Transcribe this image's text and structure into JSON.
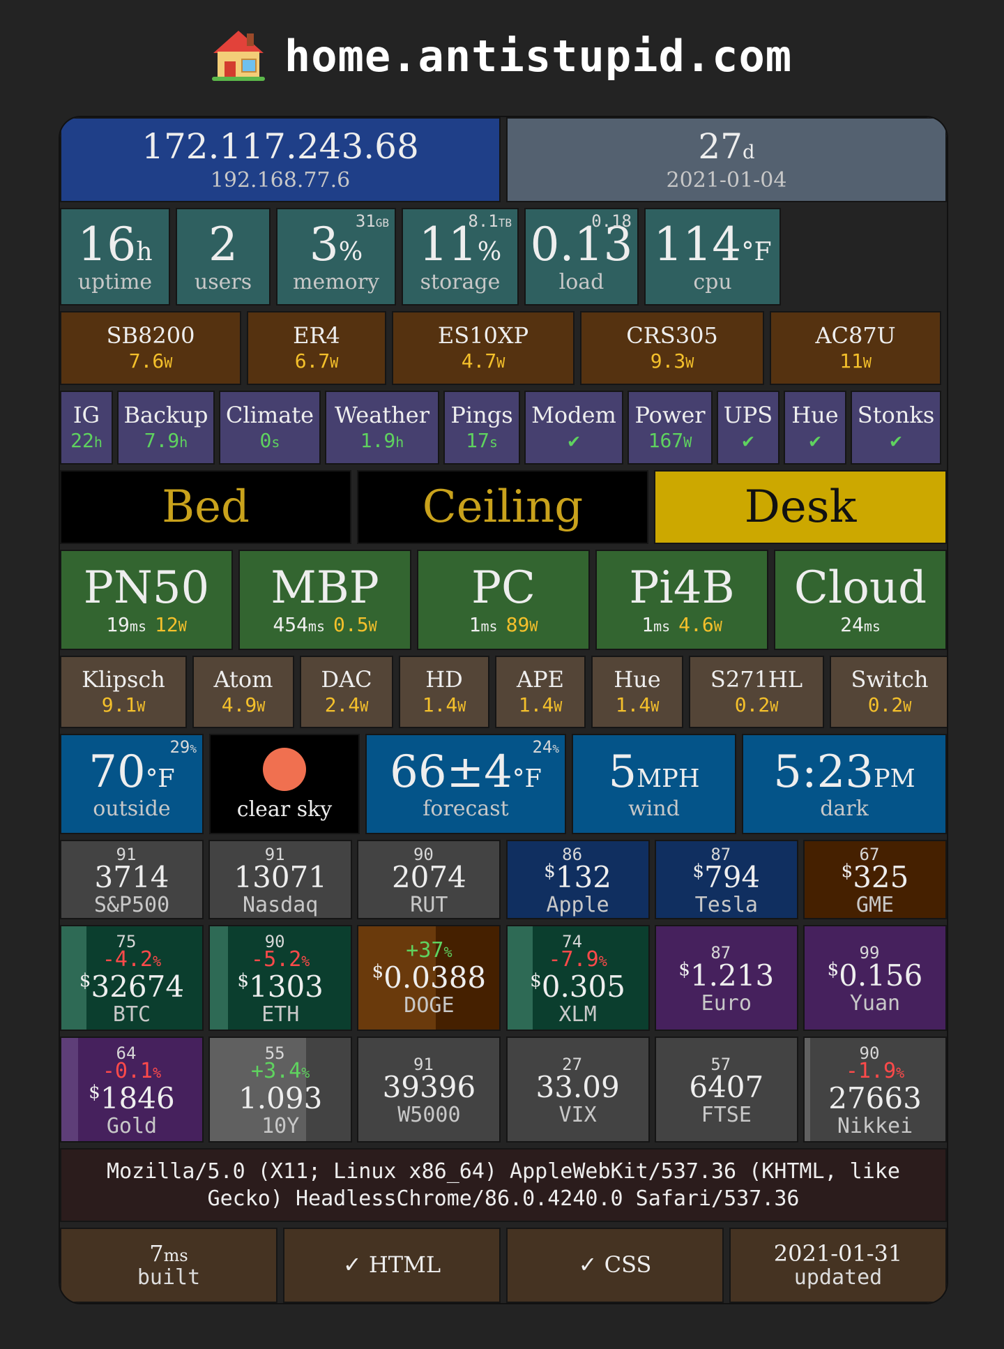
{
  "header": {
    "title": "home.antistupid.com",
    "icon": "house-icon"
  },
  "network": {
    "public_ip": "172.117.243.68",
    "local_ip": "192.168.77.6"
  },
  "age": {
    "value": "27",
    "unit": "d",
    "date": "2021-01-04"
  },
  "system": [
    {
      "value": "16",
      "unit": "h",
      "label": "uptime",
      "corner": "",
      "corner_unit": ""
    },
    {
      "value": "2",
      "unit": "",
      "label": "users",
      "corner": "",
      "corner_unit": ""
    },
    {
      "value": "3",
      "unit": "%",
      "label": "memory",
      "corner": "31",
      "corner_unit": "GB"
    },
    {
      "value": "11",
      "unit": "%",
      "label": "storage",
      "corner": "8.1",
      "corner_unit": "TB"
    },
    {
      "value": "0.13",
      "unit": "",
      "label": "load",
      "corner": "0.18",
      "corner_unit": ""
    },
    {
      "value": "114",
      "unit": "°F",
      "label": "cpu",
      "corner": "",
      "corner_unit": ""
    }
  ],
  "devices": [
    {
      "name": "SB8200",
      "value": "7.6",
      "unit": "W"
    },
    {
      "name": "ER4",
      "value": "6.7",
      "unit": "W"
    },
    {
      "name": "ES10XP",
      "value": "4.7",
      "unit": "W"
    },
    {
      "name": "CRS305",
      "value": "9.3",
      "unit": "W"
    },
    {
      "name": "AC87U",
      "value": "11",
      "unit": "W"
    }
  ],
  "services": [
    {
      "name": "IG",
      "value": "22",
      "unit": "h"
    },
    {
      "name": "Backup",
      "value": "7.9",
      "unit": "h"
    },
    {
      "name": "Climate",
      "value": "0",
      "unit": "s"
    },
    {
      "name": "Weather",
      "value": "1.9",
      "unit": "h"
    },
    {
      "name": "Pings",
      "value": "17",
      "unit": "s"
    },
    {
      "name": "Modem",
      "value": "✔",
      "unit": ""
    },
    {
      "name": "Power",
      "value": "167",
      "unit": "W"
    },
    {
      "name": "UPS",
      "value": "✔",
      "unit": ""
    },
    {
      "name": "Hue",
      "value": "✔",
      "unit": ""
    },
    {
      "name": "Stonks",
      "value": "✔",
      "unit": ""
    }
  ],
  "lights": [
    {
      "name": "Bed",
      "on": false
    },
    {
      "name": "Ceiling",
      "on": false
    },
    {
      "name": "Desk",
      "on": true
    }
  ],
  "hosts": [
    {
      "name": "PN50",
      "ping": "19",
      "ping_unit": "ms",
      "power": "12",
      "power_unit": "W"
    },
    {
      "name": "MBP",
      "ping": "454",
      "ping_unit": "ms",
      "power": "0.5",
      "power_unit": "W"
    },
    {
      "name": "PC",
      "ping": "1",
      "ping_unit": "ms",
      "power": "89",
      "power_unit": "W"
    },
    {
      "name": "Pi4B",
      "ping": "1",
      "ping_unit": "ms",
      "power": "4.6",
      "power_unit": "W"
    },
    {
      "name": "Cloud",
      "ping": "24",
      "ping_unit": "ms",
      "power": "",
      "power_unit": ""
    }
  ],
  "outlets": [
    {
      "name": "Klipsch",
      "value": "9.1",
      "unit": "W"
    },
    {
      "name": "Atom",
      "value": "4.9",
      "unit": "W"
    },
    {
      "name": "DAC",
      "value": "2.4",
      "unit": "W"
    },
    {
      "name": "HD",
      "value": "1.4",
      "unit": "W"
    },
    {
      "name": "APE",
      "value": "1.4",
      "unit": "W"
    },
    {
      "name": "Hue",
      "value": "1.4",
      "unit": "W"
    },
    {
      "name": "S271HL",
      "value": "0.2",
      "unit": "W"
    },
    {
      "name": "Switch",
      "value": "0.2",
      "unit": "W"
    }
  ],
  "weather": {
    "outside": {
      "value": "70",
      "unit": "°F",
      "label": "outside",
      "humidity": "29",
      "humidity_unit": "%"
    },
    "sky": {
      "label": "clear sky",
      "icon": "sun-icon",
      "color": "#f07050"
    },
    "forecast": {
      "value": "66±4",
      "unit": "°F",
      "label": "forecast",
      "humidity": "24",
      "humidity_unit": "%"
    },
    "wind": {
      "value": "5",
      "unit": "MPH",
      "label": "wind"
    },
    "sun": {
      "value": "5:23",
      "unit": "PM",
      "label": "dark"
    }
  },
  "stocks": [
    {
      "value": "3714",
      "dollar": "",
      "label": "S&P500",
      "score": "91"
    },
    {
      "value": "13071",
      "dollar": "",
      "label": "Nasdaq",
      "score": "91"
    },
    {
      "value": "2074",
      "dollar": "",
      "label": "RUT",
      "score": "90"
    },
    {
      "value": "132",
      "dollar": "$",
      "label": "Apple",
      "score": "86"
    },
    {
      "value": "794",
      "dollar": "$",
      "label": "Tesla",
      "score": "87"
    },
    {
      "value": "325",
      "dollar": "$",
      "label": "GME",
      "score": "67"
    }
  ],
  "crypto": [
    {
      "change": "-4.2",
      "change_unit": "%",
      "dollar": "$",
      "value": "32674",
      "label": "BTC",
      "score": "75",
      "fill": 0.18
    },
    {
      "change": "-5.2",
      "change_unit": "%",
      "dollar": "$",
      "value": "1303",
      "label": "ETH",
      "score": "90",
      "fill": 0.13
    },
    {
      "change": "+37",
      "change_unit": "%",
      "dollar": "$",
      "value": "0.0388",
      "label": "DOGE",
      "score": "",
      "fill": 0.55
    },
    {
      "change": "-7.9",
      "change_unit": "%",
      "dollar": "$",
      "value": "0.305",
      "label": "XLM",
      "score": "74",
      "fill": 0.18
    },
    {
      "change": "",
      "change_unit": "",
      "dollar": "$",
      "value": "1.213",
      "label": "Euro",
      "score": "87",
      "fill": 0
    },
    {
      "change": "",
      "change_unit": "",
      "dollar": "$",
      "value": "0.156",
      "label": "Yuan",
      "score": "99",
      "fill": 0
    }
  ],
  "markets": [
    {
      "change": "-0.1",
      "change_unit": "%",
      "dollar": "$",
      "value": "1846",
      "label": "Gold",
      "score": "64",
      "fill": 0.12
    },
    {
      "change": "+3.4",
      "change_unit": "%",
      "dollar": "",
      "value": "1.093",
      "label": "10Y",
      "score": "55",
      "fill": 0.68
    },
    {
      "change": "",
      "change_unit": "",
      "dollar": "",
      "value": "39396",
      "label": "W5000",
      "score": "91",
      "fill": 0
    },
    {
      "change": "",
      "change_unit": "",
      "dollar": "",
      "value": "33.09",
      "label": "VIX",
      "score": "27",
      "fill": 0
    },
    {
      "change": "",
      "change_unit": "",
      "dollar": "",
      "value": "6407",
      "label": "FTSE",
      "score": "57",
      "fill": 0
    },
    {
      "change": "-1.9",
      "change_unit": "%",
      "dollar": "",
      "value": "27663",
      "label": "Nikkei",
      "score": "90",
      "fill": 0.04
    }
  ],
  "user_agent": "Mozilla/5.0 (X11; Linux x86_64) AppleWebKit/537.36 (KHTML, like Gecko) HeadlessChrome/86.0.4240.0 Safari/537.36",
  "footer": {
    "build_value": "7",
    "build_unit": "ms",
    "build_label": "built",
    "html": "✓ HTML",
    "css": "✓ CSS",
    "updated_value": "2021-01-31",
    "updated_label": "updated"
  },
  "colors": {
    "teal": "#2f6060",
    "device": "#553210",
    "service": "#46406f",
    "host": "#336530",
    "outlet": "#544537",
    "weather": "#045489",
    "light_on": "#cca800",
    "light_text": "#c9a21c",
    "accent_yellow": "#f4c02b",
    "ok_green": "#5fd35f",
    "down_red": "#ff4a4a"
  }
}
